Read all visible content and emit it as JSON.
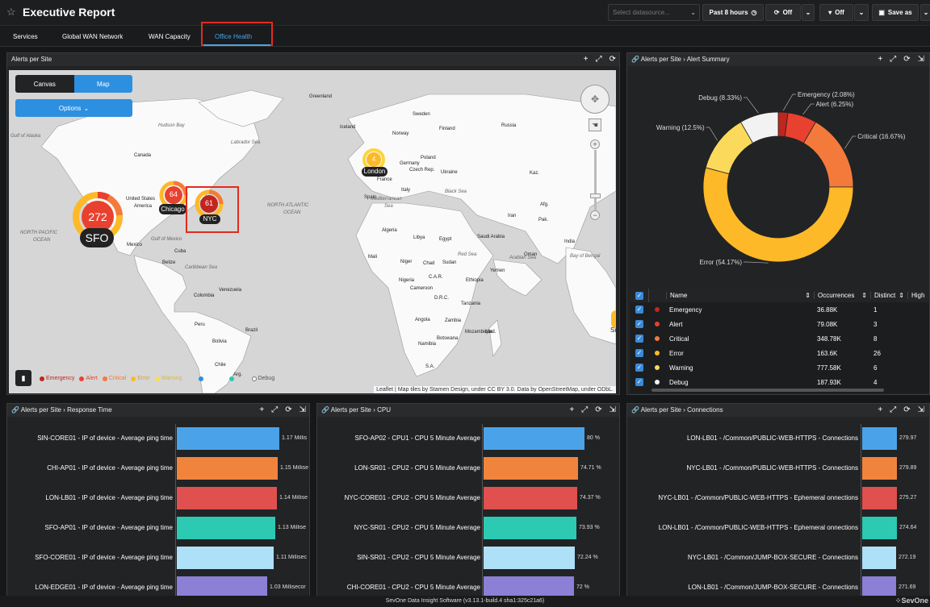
{
  "header": {
    "title": "Executive Report",
    "datasource_placeholder": "Select datasource...",
    "time_range": "Past 8 hours",
    "refresh": "Off",
    "filter": "Off",
    "save": "Save as"
  },
  "tabs": [
    "Services",
    "Global WAN Network",
    "WAN Capacity",
    "Office Health"
  ],
  "active_tab": "Office Health",
  "map_panel": {
    "title": "Alerts per Site",
    "toggle": [
      "Canvas",
      "Map"
    ],
    "options": "Options",
    "sites": [
      {
        "name": "SFO",
        "count": "272"
      },
      {
        "name": "Chicago",
        "count": "64"
      },
      {
        "name": "NYC",
        "count": "61"
      },
      {
        "name": "London",
        "count": "4"
      }
    ],
    "legend": [
      "Emergency",
      "Alert",
      "Critical",
      "Error",
      "Warning",
      "Debug"
    ],
    "attribution": "Leaflet | Map tiles by Stamen Design, under CC BY 3.0. Data by OpenStreetMap, under ODbL.",
    "labels": [
      "Hudson Bay",
      "Labrador Sea",
      "Gulf of Alaska",
      "Canada",
      "United States",
      "America",
      "Mexico",
      "Gulf of Mexico",
      "Cuba",
      "Belize",
      "Caribbean Sea",
      "NORTH PACIFIC",
      "OCEAN",
      "NORTH ATLANTIC",
      "OCEAN",
      "Greenland",
      "Iceland",
      "Norway",
      "Sweden",
      "Finland",
      "Russia",
      "Poland",
      "Ukraine",
      "Germany",
      "France",
      "Spain",
      "Italy",
      "Czech Rep.",
      "Kaz.",
      "Black Sea",
      "Mediterranean",
      "Sea",
      "Libya",
      "Egypt",
      "Algeria",
      "Mali",
      "Niger",
      "Chad",
      "Sudan",
      "Nigeria",
      "Ethiopia",
      "Red Sea",
      "D.R.C.",
      "Tanzania",
      "Angola",
      "Namibia",
      "Brazil",
      "Peru",
      "Bolivia",
      "Chile",
      "Arg.",
      "Colombia",
      "Venezuela",
      "Iran",
      "Saudi Arabia",
      "Arabian Sea",
      "Bay of Bengal",
      "India",
      "Pak.",
      "Afg.",
      "Yemen",
      "Oman",
      "Mad.",
      "S.A.",
      "Botswana",
      "Mozambique",
      "Zambia",
      "C.A.R.",
      "Cameroon",
      "Si"
    ]
  },
  "donut_panel": {
    "breadcrumb": [
      "Alerts per Site",
      "Alert Summary"
    ],
    "slices": [
      {
        "label": "Emergency (2.08%)",
        "value": 2.08,
        "color": "#c0261e"
      },
      {
        "label": "Alert (6.25%)",
        "value": 6.25,
        "color": "#e8412f"
      },
      {
        "label": "Critical (16.67%)",
        "value": 16.67,
        "color": "#f47a3c"
      },
      {
        "label": "Error (54.17%)",
        "value": 54.17,
        "color": "#fdb927"
      },
      {
        "label": "Warning (12.5%)",
        "value": 12.5,
        "color": "#fbd95b"
      },
      {
        "label": "Debug (8.33%)",
        "value": 8.33,
        "color": "#f2f2f2"
      }
    ],
    "table": {
      "headers": [
        "Name",
        "Occurrences",
        "Distinct",
        "High"
      ],
      "rows": [
        [
          "Emergency",
          "36.88K",
          "1"
        ],
        [
          "Alert",
          "79.08K",
          "3"
        ],
        [
          "Critical",
          "348.78K",
          "8"
        ],
        [
          "Error",
          "163.6K",
          "26"
        ],
        [
          "Warning",
          "777.58K",
          "6"
        ],
        [
          "Debug",
          "187.93K",
          "4"
        ]
      ]
    }
  },
  "bar_panels": [
    {
      "breadcrumb": [
        "Alerts per Site",
        "Response Time"
      ],
      "max": 1.2,
      "rows": [
        {
          "label": "SIN-CORE01 - IP of device - Average ping time",
          "value": 1.17,
          "text": "1.17 Millis"
        },
        {
          "label": "CHI-AP01 - IP of device - Average ping time",
          "value": 1.15,
          "text": "1.15 Millise"
        },
        {
          "label": "LON-LB01 - IP of device - Average ping time",
          "value": 1.14,
          "text": "1.14 Millise"
        },
        {
          "label": "SFO-AP01 - IP of device - Average ping time",
          "value": 1.13,
          "text": "1.13 Millise"
        },
        {
          "label": "SFO-CORE01 - IP of device - Average ping time",
          "value": 1.11,
          "text": "1.11 Millisec"
        },
        {
          "label": "LON-EDGE01 - IP of device - Average ping time",
          "value": 1.03,
          "text": "1.03 Millisecor"
        }
      ]
    },
    {
      "breadcrumb": [
        "Alerts per Site",
        "CPU"
      ],
      "max": 82,
      "rows": [
        {
          "label": "SFO-AP02 - CPU1 - CPU 5 Minute Average",
          "value": 80,
          "text": "80 %"
        },
        {
          "label": "LON-SR01 - CPU2 - CPU 5 Minute Average",
          "value": 74.71,
          "text": "74.71 %"
        },
        {
          "label": "NYC-CORE01 - CPU2 - CPU 5 Minute Average",
          "value": 74.37,
          "text": "74.37 %"
        },
        {
          "label": "NYC-SR01 - CPU2 - CPU 5 Minute Average",
          "value": 73.93,
          "text": "73.93 %"
        },
        {
          "label": "SIN-SR01 - CPU2 - CPU 5 Minute Average",
          "value": 72.24,
          "text": "72.24 %"
        },
        {
          "label": "CHI-CORE01 - CPU2 - CPU 5 Minute Average",
          "value": 72,
          "text": "72 %"
        }
      ]
    },
    {
      "breadcrumb": [
        "Alerts per Site",
        "Connections"
      ],
      "max": 290,
      "rows": [
        {
          "label": "LON-LB01 - /Common/PUBLIC-WEB-HTTPS - Connections",
          "value": 279.97,
          "text": "279.97"
        },
        {
          "label": "NYC-LB01 - /Common/PUBLIC-WEB-HTTPS - Connections",
          "value": 279.89,
          "text": "279.89"
        },
        {
          "label": "NYC-LB01 - /Common/PUBLIC-WEB-HTTPS - Ephemeral onnections",
          "value": 275.27,
          "text": "275.27"
        },
        {
          "label": "LON-LB01 - /Common/PUBLIC-WEB-HTTPS - Ephemeral onnections",
          "value": 274.64,
          "text": "274.64"
        },
        {
          "label": "NYC-LB01 - /Common/JUMP-BOX-SECURE - Connections",
          "value": 272.19,
          "text": "272.19"
        },
        {
          "label": "LON-LB01 - /Common/JUMP-BOX-SECURE - Connections",
          "value": 271.69,
          "text": "271.69"
        }
      ]
    }
  ],
  "bar_colors": [
    "#4aa3e8",
    "#f0843d",
    "#e0504e",
    "#2cc9b3",
    "#aee0f7",
    "#8c7fd6"
  ],
  "footer": "SevOne Data Insight Software (v3.13.1-build.4 sha1:325c21a6)",
  "logo": "SevOne"
}
